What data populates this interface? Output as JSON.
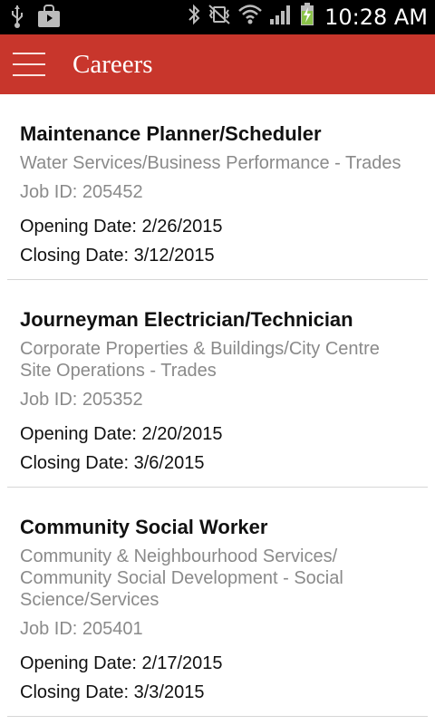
{
  "status_bar": {
    "time": "10:28 AM",
    "icons": [
      "usb-icon",
      "shopping-bag-icon",
      "bluetooth-icon",
      "vibrate-muted-icon",
      "wifi-icon",
      "signal-icon",
      "battery-charging-icon"
    ],
    "accent": "#8bc34a"
  },
  "app_bar": {
    "title": "Careers",
    "color": "#c8362c"
  },
  "jobs": [
    {
      "title": "Maintenance Planner/Scheduler",
      "department": "Water Services/Business Performance - Trades",
      "job_id": "Job ID: 205452",
      "opening": "Opening Date: 2/26/2015",
      "closing": "Closing Date: 3/12/2015"
    },
    {
      "title": "Journeyman Electrician/Technician",
      "department": "Corporate Properties & Buildings/City Centre Site Operations - Trades",
      "job_id": "Job ID: 205352",
      "opening": "Opening Date: 2/20/2015",
      "closing": "Closing Date: 3/6/2015"
    },
    {
      "title": "Community Social Worker",
      "department": "Community & Neighbourhood Services/ Community Social Development - Social Science/Services",
      "job_id": "Job ID: 205401",
      "opening": "Opening Date: 2/17/2015",
      "closing": "Closing Date: 3/3/2015"
    }
  ]
}
